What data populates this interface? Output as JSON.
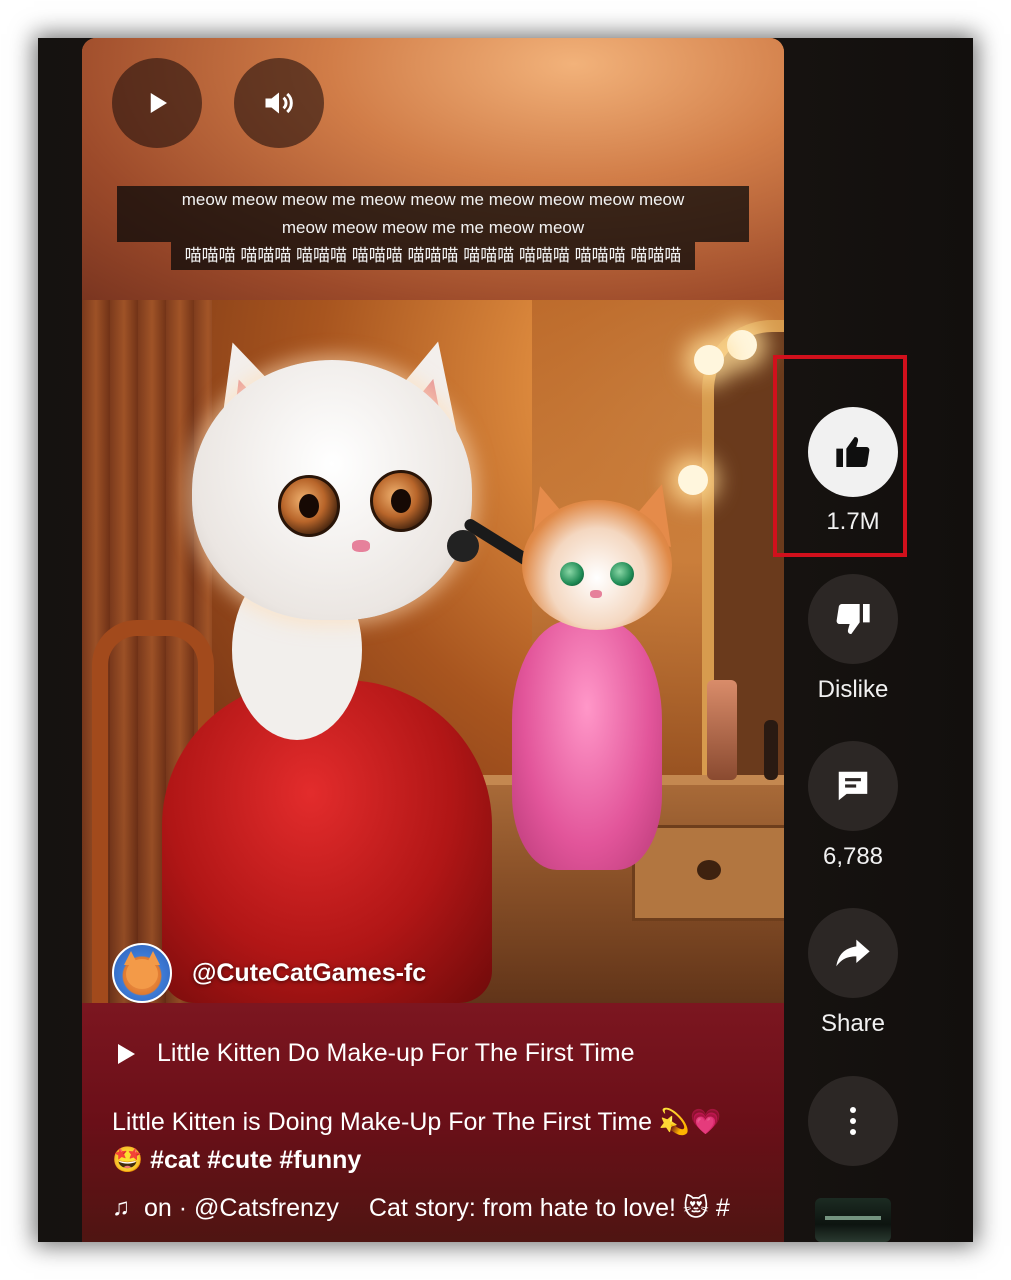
{
  "player": {
    "play_icon": "play-icon",
    "volume_icon": "volume-icon"
  },
  "captions": {
    "line1": "meow meow meow me meow meow me meow meow meow meow",
    "line2": "meow meow meow me me meow meow",
    "line3": "喵喵喵 喵喵喵 喵喵喵 喵喵喵 喵喵喵 喵喵喵 喵喵喵 喵喵喵 喵喵喵"
  },
  "channel": {
    "handle": "@CuteCatGames-fc"
  },
  "related_video": {
    "title": "Little Kitten Do Make-up For The First Time"
  },
  "description": {
    "text": "Little Kitten is Doing Make-Up  For The First Time 💫💗",
    "emoji_prefix": "🤩",
    "tags": "#cat #cute #funny"
  },
  "music": {
    "note_icon": "music-note-icon",
    "source": "on · @Catsfrenzy",
    "track": "Cat story: from hate to love! 😻 #"
  },
  "actions": {
    "like": {
      "icon": "thumbs-up-icon",
      "count": "1.7M"
    },
    "dislike": {
      "icon": "thumbs-down-icon",
      "label": "Dislike"
    },
    "comments": {
      "icon": "comment-icon",
      "count": "6,788"
    },
    "share": {
      "icon": "share-icon",
      "label": "Share"
    },
    "more": {
      "icon": "more-vert-icon"
    }
  },
  "colors": {
    "highlight": "#d1101c",
    "like_bg": "#f1f1f1",
    "action_bg": "#2c2725"
  }
}
